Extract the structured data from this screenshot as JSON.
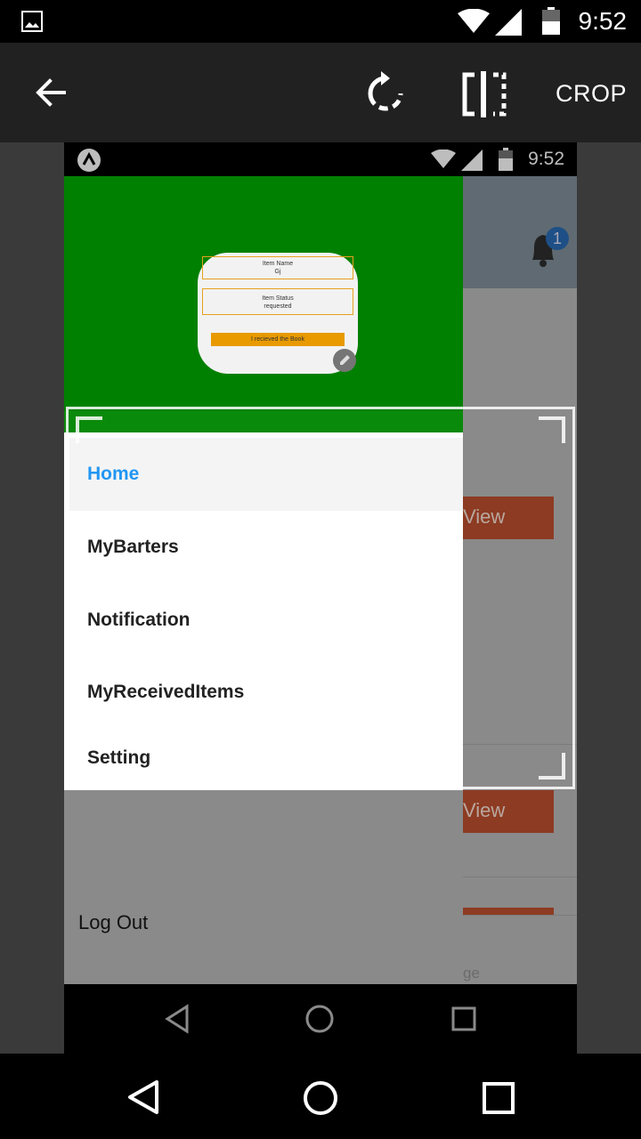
{
  "status_bar": {
    "time": "9:52"
  },
  "toolbar": {
    "crop_label": "CROP"
  },
  "screenshot": {
    "status_time": "9:52",
    "card": {
      "name_label": "Item Name",
      "name_value": "Gj",
      "status_label": "Item Status",
      "status_value": "requested",
      "button_label": "I recieved the Book"
    },
    "badge_count": "1",
    "drawer": {
      "items": [
        {
          "label": "Home"
        },
        {
          "label": "MyBarters"
        },
        {
          "label": "Notification"
        },
        {
          "label": "MyReceivedItems"
        },
        {
          "label": "Setting"
        }
      ],
      "logout_label": "Log Out"
    },
    "background": {
      "view_label": "View",
      "page_partial": "ge"
    }
  },
  "colors": {
    "accent": "#2196f3",
    "drawer_header": "#008000",
    "view_button": "#8d3b22"
  }
}
